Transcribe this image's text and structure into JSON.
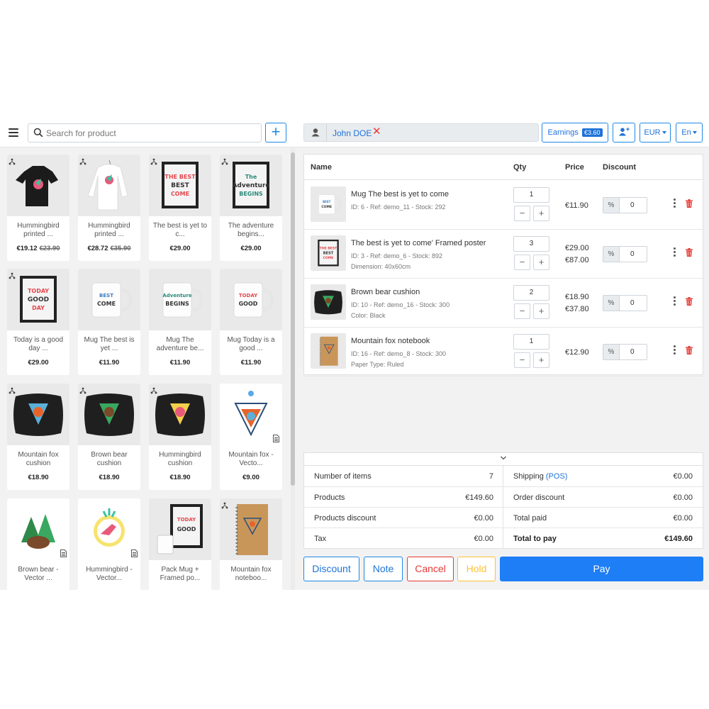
{
  "search": {
    "placeholder": "Search for product"
  },
  "add_product": {
    "label": "+"
  },
  "products": [
    {
      "name": "Hummingbird printed ...",
      "price": "€19.12",
      "old_price": "€23.90",
      "variant": true,
      "thumb": "tshirt-dark"
    },
    {
      "name": "Hummingbird printed ...",
      "price": "€28.72",
      "old_price": "€35.90",
      "variant": true,
      "thumb": "sweater-white"
    },
    {
      "name": "The best is yet to c...",
      "price": "€29.00",
      "old_price": "",
      "variant": true,
      "thumb": "poster-best"
    },
    {
      "name": "The adventure begins...",
      "price": "€29.00",
      "old_price": "",
      "variant": true,
      "thumb": "poster-adventure"
    },
    {
      "name": "Today is a good day ...",
      "price": "€29.00",
      "old_price": "",
      "variant": true,
      "thumb": "poster-today"
    },
    {
      "name": "Mug The best is yet ...",
      "price": "€11.90",
      "old_price": "",
      "variant": false,
      "thumb": "mug-best"
    },
    {
      "name": "Mug The adventure be...",
      "price": "€11.90",
      "old_price": "",
      "variant": false,
      "thumb": "mug-adventure"
    },
    {
      "name": "Mug Today is a good ...",
      "price": "€11.90",
      "old_price": "",
      "variant": false,
      "thumb": "mug-today"
    },
    {
      "name": "Mountain fox cushion",
      "price": "€18.90",
      "old_price": "",
      "variant": true,
      "thumb": "cushion-fox"
    },
    {
      "name": "Brown bear cushion",
      "price": "€18.90",
      "old_price": "",
      "variant": true,
      "thumb": "cushion-bear"
    },
    {
      "name": "Hummingbird cushion",
      "price": "€18.90",
      "old_price": "",
      "variant": true,
      "thumb": "cushion-bird"
    },
    {
      "name": "Mountain fox - Vecto...",
      "price": "€9.00",
      "old_price": "",
      "variant": false,
      "thumb": "vector-fox",
      "download": true
    },
    {
      "name": "Brown bear - Vector ...",
      "price": "",
      "old_price": "",
      "variant": false,
      "thumb": "vector-bear",
      "download": true
    },
    {
      "name": "Hummingbird - Vector...",
      "price": "",
      "old_price": "",
      "variant": false,
      "thumb": "vector-bird",
      "download": true
    },
    {
      "name": "Pack Mug + Framed po...",
      "price": "",
      "old_price": "",
      "variant": false,
      "thumb": "pack"
    },
    {
      "name": "Mountain fox noteboo...",
      "price": "",
      "old_price": "",
      "variant": true,
      "thumb": "notebook"
    }
  ],
  "customer": {
    "name": "John DOE",
    "remove": "✕"
  },
  "earnings": {
    "label": "Earnings",
    "amount": "€3.60"
  },
  "currency": "EUR",
  "language": "En",
  "cart": {
    "headers": {
      "name": "Name",
      "qty": "Qty",
      "price": "Price",
      "discount": "Discount"
    },
    "rows": [
      {
        "title": "Mug The best is yet to come",
        "meta1": "ID: 6 - Ref: demo_11 - Stock: 292",
        "meta2": "",
        "qty": "1",
        "unit_price": "€11.90",
        "total_price": "",
        "discount_type": "%",
        "discount": "0",
        "thumb": "mug-best"
      },
      {
        "title": "The best is yet to come' Framed poster",
        "meta1": "ID: 3 - Ref: demo_6 - Stock: 892",
        "meta2": "Dimension: 40x60cm",
        "qty": "3",
        "unit_price": "€29.00",
        "total_price": "€87.00",
        "discount_type": "%",
        "discount": "0",
        "thumb": "poster-best"
      },
      {
        "title": "Brown bear cushion",
        "meta1": "ID: 10 - Ref: demo_16 - Stock: 300",
        "meta2": "Color: Black",
        "qty": "2",
        "unit_price": "€18.90",
        "total_price": "€37.80",
        "discount_type": "%",
        "discount": "0",
        "thumb": "cushion-bear"
      },
      {
        "title": "Mountain fox notebook",
        "meta1": "ID: 16 - Ref: demo_8 - Stock: 300",
        "meta2": "Paper Type: Ruled",
        "qty": "1",
        "unit_price": "€12.90",
        "total_price": "",
        "discount_type": "%",
        "discount": "0",
        "thumb": "notebook"
      }
    ]
  },
  "summary": {
    "left": [
      {
        "label": "Number of items",
        "value": "7"
      },
      {
        "label": "Products",
        "value": "€149.60"
      },
      {
        "label": "Products discount",
        "value": "€0.00"
      },
      {
        "label": "Tax",
        "value": "€0.00"
      }
    ],
    "right": [
      {
        "label": "Shipping",
        "label_extra": "(POS)",
        "value": "€0.00"
      },
      {
        "label": "Order discount",
        "label_extra": "",
        "value": "€0.00"
      },
      {
        "label": "Total paid",
        "label_extra": "",
        "value": "€0.00"
      },
      {
        "label": "Total to pay",
        "label_extra": "",
        "value": "€149.60"
      }
    ]
  },
  "actions": {
    "discount": "Discount",
    "note": "Note",
    "cancel": "Cancel",
    "hold": "Hold",
    "pay": "Pay"
  },
  "colors": {
    "primary": "#1e7ef5",
    "danger": "#e53935",
    "warning": "#ffc233",
    "background": "#f2f2f2"
  }
}
